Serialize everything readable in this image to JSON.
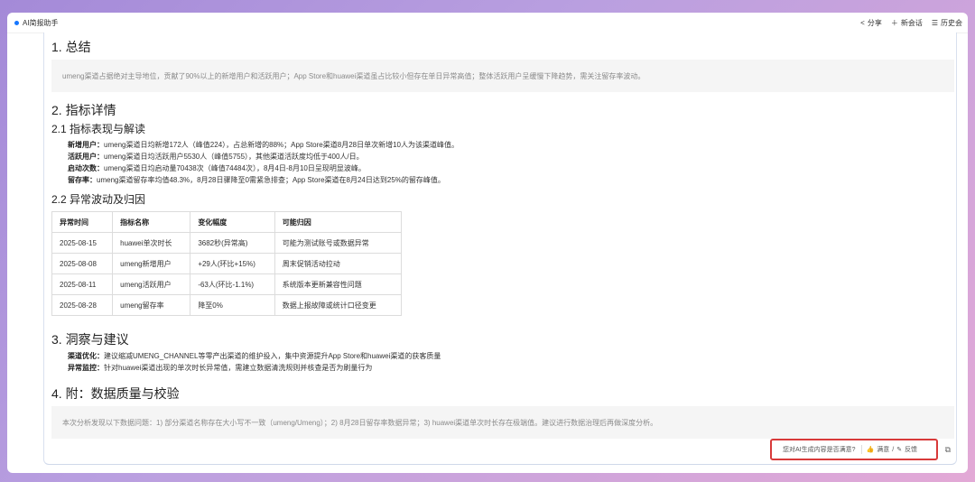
{
  "app": {
    "title": "AI简报助手"
  },
  "toolbar": {
    "share": "分享",
    "new_chat": "新会话",
    "history": "历史会"
  },
  "sections": {
    "s1": {
      "title": "1. 总结",
      "summary": "umeng渠道占据绝对主导地位，贡献了90%以上的新增用户和活跃用户；App Store和huawei渠道虽占比较小但存在单日异常高值；整体活跃用户呈缓慢下降趋势，需关注留存率波动。"
    },
    "s2": {
      "title": "2. 指标详情",
      "sub1": "2.1 指标表现与解读",
      "metrics": [
        {
          "label": "新增用户：",
          "text": "umeng渠道日均新增172人（峰值224），占总新增的88%；App Store渠道8月28日单次新增10人为该渠道峰值。"
        },
        {
          "label": "活跃用户：",
          "text": "umeng渠道日均活跃用户5530人（峰值5755），其他渠道活跃度均低于400人/日。"
        },
        {
          "label": "启动次数：",
          "text": "umeng渠道日均启动量70438次（峰值74484次），8月4日-8月10日呈现明显波峰。"
        },
        {
          "label": "留存率：",
          "text": "umeng渠道留存率均值48.3%，8月28日骤降至0需紧急排查；App Store渠道在8月24日达到25%的留存峰值。"
        }
      ],
      "sub2": "2.2 异常波动及归因",
      "table": {
        "headers": [
          "异常时间",
          "指标名称",
          "变化幅度",
          "可能归因"
        ],
        "rows": [
          [
            "2025-08-15",
            "huawei单次时长",
            "3682秒(异常高)",
            "可能为测试账号或数据异常"
          ],
          [
            "2025-08-08",
            "umeng新增用户",
            "+29人(环比+15%)",
            "周末促销活动拉动"
          ],
          [
            "2025-08-11",
            "umeng活跃用户",
            "-63人(环比-1.1%)",
            "系统版本更新兼容性问题"
          ],
          [
            "2025-08-28",
            "umeng留存率",
            "降至0%",
            "数据上报故障或统计口径变更"
          ]
        ]
      }
    },
    "s3": {
      "title": "3. 洞察与建议",
      "items": [
        {
          "label": "渠道优化：",
          "text": "建议缩减UMENG_CHANNEL等零产出渠道的维护投入，集中资源提升App Store和huawei渠道的获客质量"
        },
        {
          "label": "异常监控：",
          "text": "针对huawei渠道出现的单次时长异常值，需建立数据清洗规则并核查是否为刷量行为"
        }
      ]
    },
    "s4": {
      "title": "4. 附：数据质量与校验",
      "summary": "本次分析发现以下数据问题：1) 部分渠道名称存在大小写不一致（umeng/Umeng）；2) 8月28日留存率数据异常；3) huawei渠道单次时长存在极端值。建议进行数据治理后再做深度分析。"
    }
  },
  "feedback": {
    "question": "您对AI生成内容是否满意?",
    "satisfied": "满意",
    "separator": "/",
    "report": "反馈"
  },
  "colors": {
    "accent": "#1677ff",
    "highlight_border": "#d83a3a",
    "frame_gradient": [
      "#a48ad8",
      "#e3a9d6"
    ]
  },
  "icons": {
    "share": "share-icon",
    "new_chat": "plus-icon",
    "history": "history-icon",
    "like": "thumbs-up-icon",
    "edit": "pencil-icon",
    "copy": "copy-icon"
  }
}
